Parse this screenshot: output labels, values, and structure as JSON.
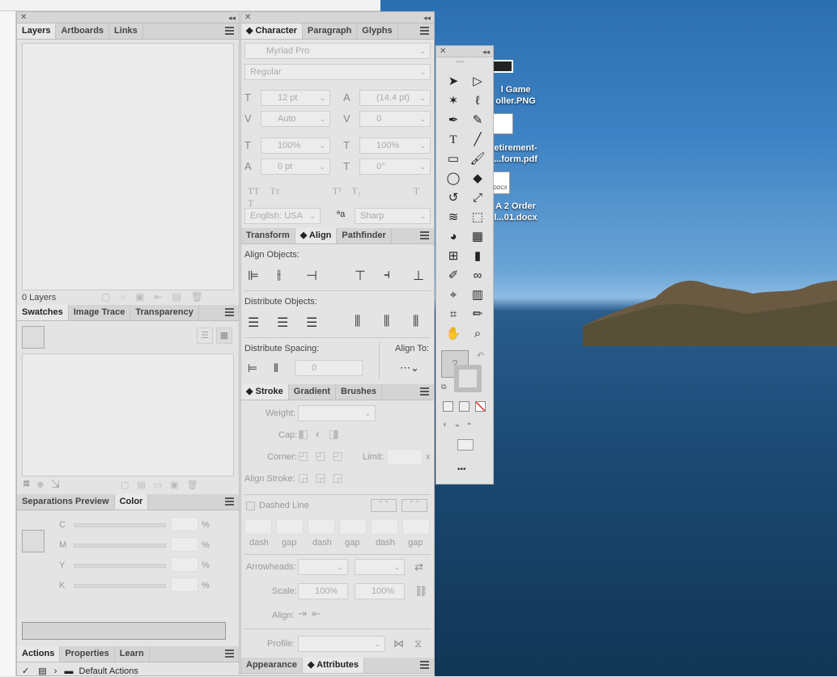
{
  "desktop": {
    "icons": [
      {
        "line1": "l Game",
        "line2": "oller.PNG"
      },
      {
        "line1": "etirement-",
        "line2": "...form.pdf"
      },
      {
        "line1": "A 2 Order",
        "line2": "l...01.docx"
      }
    ],
    "docx_tag": "DOCX"
  },
  "layers_panel": {
    "tabs": [
      "Layers",
      "Artboards",
      "Links"
    ],
    "status": "0 Layers"
  },
  "swatches_panel": {
    "tabs": [
      "Swatches",
      "Image Trace",
      "Transparency"
    ]
  },
  "color_panel": {
    "tabs": [
      "Separations Preview",
      "Color"
    ],
    "channels": [
      "C",
      "M",
      "Y",
      "K"
    ],
    "unit": "%"
  },
  "actions_panel": {
    "tabs": [
      "Actions",
      "Properties",
      "Learn"
    ],
    "row": "Default Actions"
  },
  "character_panel": {
    "tabs": [
      "Character",
      "Paragraph",
      "Glyphs"
    ],
    "font": "Myriad Pro",
    "style": "Regular",
    "size": "12 pt",
    "leading": "(14.4 pt)",
    "kerning": "Auto",
    "tracking": "0",
    "vscale": "100%",
    "hscale": "100%",
    "baseline": "0 pt",
    "rotation": "0°",
    "language": "English: USA",
    "antialias": "Sharp"
  },
  "align_panel": {
    "tabs": [
      "Transform",
      "Align",
      "Pathfinder"
    ],
    "align_objects": "Align Objects:",
    "distribute_objects": "Distribute Objects:",
    "distribute_spacing": "Distribute Spacing:",
    "align_to": "Align To:",
    "spacing_value": "0"
  },
  "stroke_panel": {
    "tabs": [
      "Stroke",
      "Gradient",
      "Brushes"
    ],
    "weight": "Weight:",
    "cap": "Cap:",
    "corner": "Corner:",
    "limit": "Limit:",
    "limit_unit": "x",
    "align_stroke": "Align Stroke:",
    "dashed_line": "Dashed Line",
    "dash_labels": [
      "dash",
      "gap",
      "dash",
      "gap",
      "dash",
      "gap"
    ],
    "arrowheads": "Arrowheads:",
    "scale": "Scale:",
    "scale_v1": "100%",
    "scale_v2": "100%",
    "align": "Align:",
    "profile": "Profile:"
  },
  "bottom_panel": {
    "tabs": [
      "Appearance",
      "Attributes"
    ]
  },
  "tools_panel": {
    "more": "•••",
    "question": "?"
  }
}
